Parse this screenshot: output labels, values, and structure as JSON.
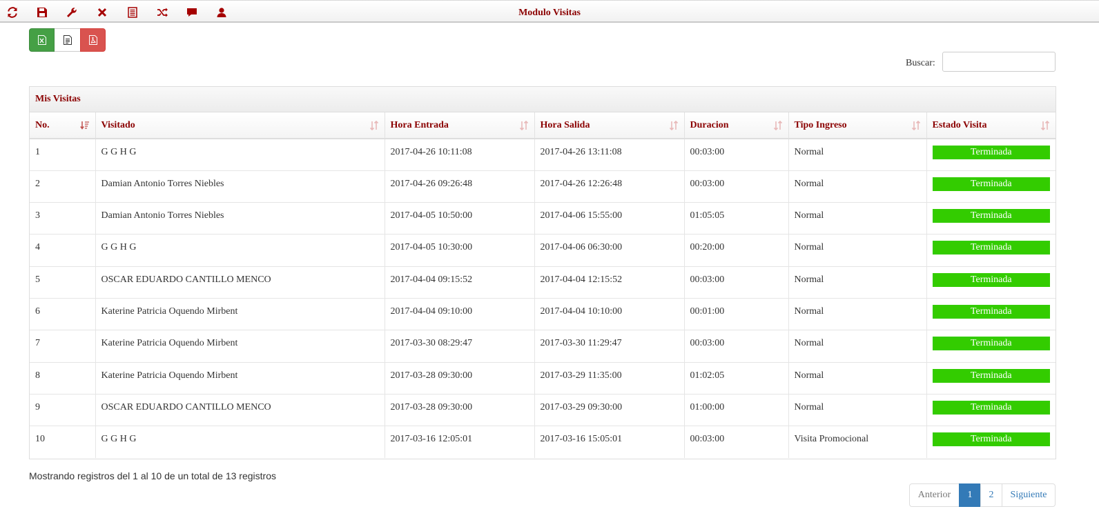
{
  "toolbar": {
    "title": "Modulo Visitas",
    "icons": [
      "refresh-icon",
      "save-icon",
      "wrench-icon",
      "close-icon",
      "list-icon",
      "shuffle-icon",
      "comment-icon",
      "user-icon"
    ],
    "icon_color": "#a50000"
  },
  "export_buttons": {
    "excel_icon": "excel-file-icon",
    "text_icon": "text-file-icon",
    "pdf_icon": "pdf-file-icon"
  },
  "search": {
    "label": "Buscar:",
    "value": "",
    "placeholder": ""
  },
  "panel": {
    "title": "Mis Visitas",
    "columns": [
      "No.",
      "Visitado",
      "Hora Entrada",
      "Hora Salida",
      "Duracion",
      "Tipo Ingreso",
      "Estado Visita"
    ],
    "rows": [
      {
        "no": "1",
        "visitado": "G G H G",
        "entrada": "2017-04-26 10:11:08",
        "salida": "2017-04-26 13:11:08",
        "duracion": "00:03:00",
        "tipo": "Normal",
        "estado": "Terminada"
      },
      {
        "no": "2",
        "visitado": "Damian Antonio Torres Niebles",
        "entrada": "2017-04-26 09:26:48",
        "salida": "2017-04-26 12:26:48",
        "duracion": "00:03:00",
        "tipo": "Normal",
        "estado": "Terminada"
      },
      {
        "no": "3",
        "visitado": "Damian Antonio Torres Niebles",
        "entrada": "2017-04-05 10:50:00",
        "salida": "2017-04-06 15:55:00",
        "duracion": "01:05:05",
        "tipo": "Normal",
        "estado": "Terminada"
      },
      {
        "no": "4",
        "visitado": "G G H G",
        "entrada": "2017-04-05 10:30:00",
        "salida": "2017-04-06 06:30:00",
        "duracion": "00:20:00",
        "tipo": "Normal",
        "estado": "Terminada"
      },
      {
        "no": "5",
        "visitado": "OSCAR EDUARDO CANTILLO MENCO",
        "entrada": "2017-04-04 09:15:52",
        "salida": "2017-04-04 12:15:52",
        "duracion": "00:03:00",
        "tipo": "Normal",
        "estado": "Terminada"
      },
      {
        "no": "6",
        "visitado": "Katerine Patricia Oquendo Mirbent",
        "entrada": "2017-04-04 09:10:00",
        "salida": "2017-04-04 10:10:00",
        "duracion": "00:01:00",
        "tipo": "Normal",
        "estado": "Terminada"
      },
      {
        "no": "7",
        "visitado": "Katerine Patricia Oquendo Mirbent",
        "entrada": "2017-03-30 08:29:47",
        "salida": "2017-03-30 11:29:47",
        "duracion": "00:03:00",
        "tipo": "Normal",
        "estado": "Terminada"
      },
      {
        "no": "8",
        "visitado": "Katerine Patricia Oquendo Mirbent",
        "entrada": "2017-03-28 09:30:00",
        "salida": "2017-03-29 11:35:00",
        "duracion": "01:02:05",
        "tipo": "Normal",
        "estado": "Terminada"
      },
      {
        "no": "9",
        "visitado": "OSCAR EDUARDO CANTILLO MENCO",
        "entrada": "2017-03-28 09:30:00",
        "salida": "2017-03-29 09:30:00",
        "duracion": "01:00:00",
        "tipo": "Normal",
        "estado": "Terminada"
      },
      {
        "no": "10",
        "visitado": "G G H G",
        "entrada": "2017-03-16 12:05:01",
        "salida": "2017-03-16 15:05:01",
        "duracion": "00:03:00",
        "tipo": "Visita Promocional",
        "estado": "Terminada"
      }
    ],
    "status_color": "#33cc00"
  },
  "footer": {
    "info": "Mostrando registros del 1 al 10 de un total de 13 registros",
    "pagination": {
      "prev": "Anterior",
      "pages": [
        "1",
        "2"
      ],
      "next": "Siguiente",
      "active": "1"
    }
  }
}
